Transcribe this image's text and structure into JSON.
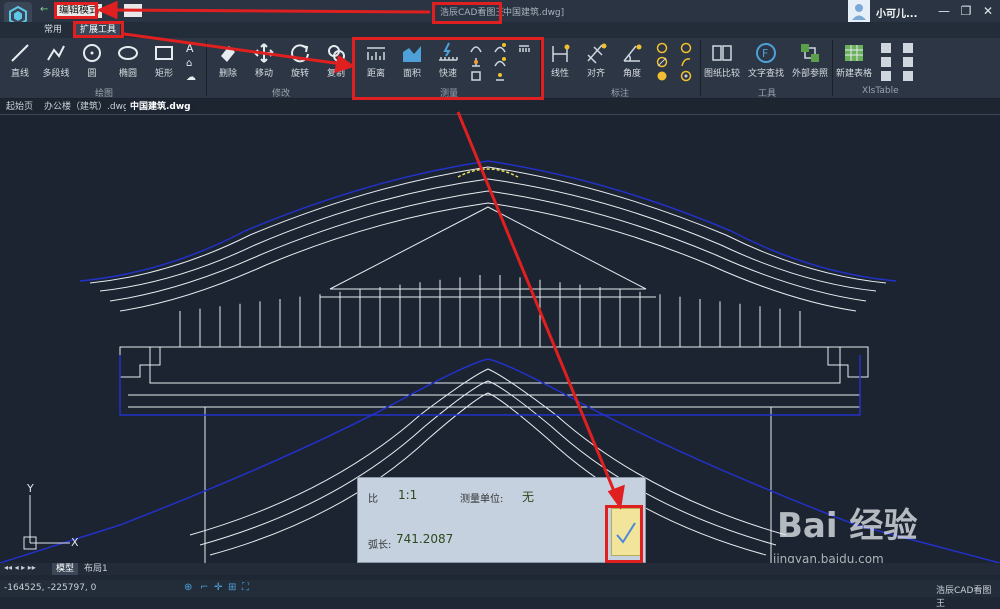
{
  "title": {
    "mode": "编辑模式",
    "app": "浩辰CAD看图王",
    "file": "中国建筑.dwg]",
    "user": "小可儿..."
  },
  "window_controls": [
    "—",
    "❐",
    "✕"
  ],
  "menu_tabs": [
    "常用",
    "扩展工具"
  ],
  "ribbon": {
    "draw": {
      "label": "绘图",
      "tools": [
        "直线",
        "多段线",
        "圆",
        "椭圆",
        "矩形"
      ]
    },
    "modify": {
      "label": "修改",
      "tools": [
        "删除",
        "移动",
        "旋转",
        "复制"
      ]
    },
    "measure": {
      "label": "测量",
      "tools": [
        "距离",
        "面积",
        "快速"
      ]
    },
    "annotate": {
      "label": "标注",
      "tools": [
        "线性",
        "对齐",
        "角度"
      ]
    },
    "tools": {
      "label": "工具",
      "tools": [
        "图纸比较",
        "文字查找",
        "外部参照"
      ]
    },
    "xls": {
      "label": "XlsTable",
      "tools": [
        "新建表格"
      ]
    }
  },
  "doc_tabs": [
    "起始页",
    "办公楼（建筑）.dwg",
    "中国建筑.dwg"
  ],
  "layout_tabs": [
    "模型",
    "布局1"
  ],
  "measure_panel": {
    "scale_label": "比",
    "scale_value": "1:1",
    "unit_label": "测量单位:",
    "unit_value": "无",
    "arc_label": "弧长:",
    "arc_value": "741.2087"
  },
  "axis": {
    "y": "Y",
    "x": "X"
  },
  "status": {
    "coords": "-164525, -225797, 0",
    "app": "浩辰CAD看图王"
  },
  "watermark": {
    "brand": "Bai 经验",
    "url": "jingyan.baidu.com"
  },
  "colors": {
    "highlight": "#e02020",
    "drawing_line": "#e8ecf0",
    "outline_blue": "#2231c8",
    "arc_yellow": "#f0e060"
  }
}
